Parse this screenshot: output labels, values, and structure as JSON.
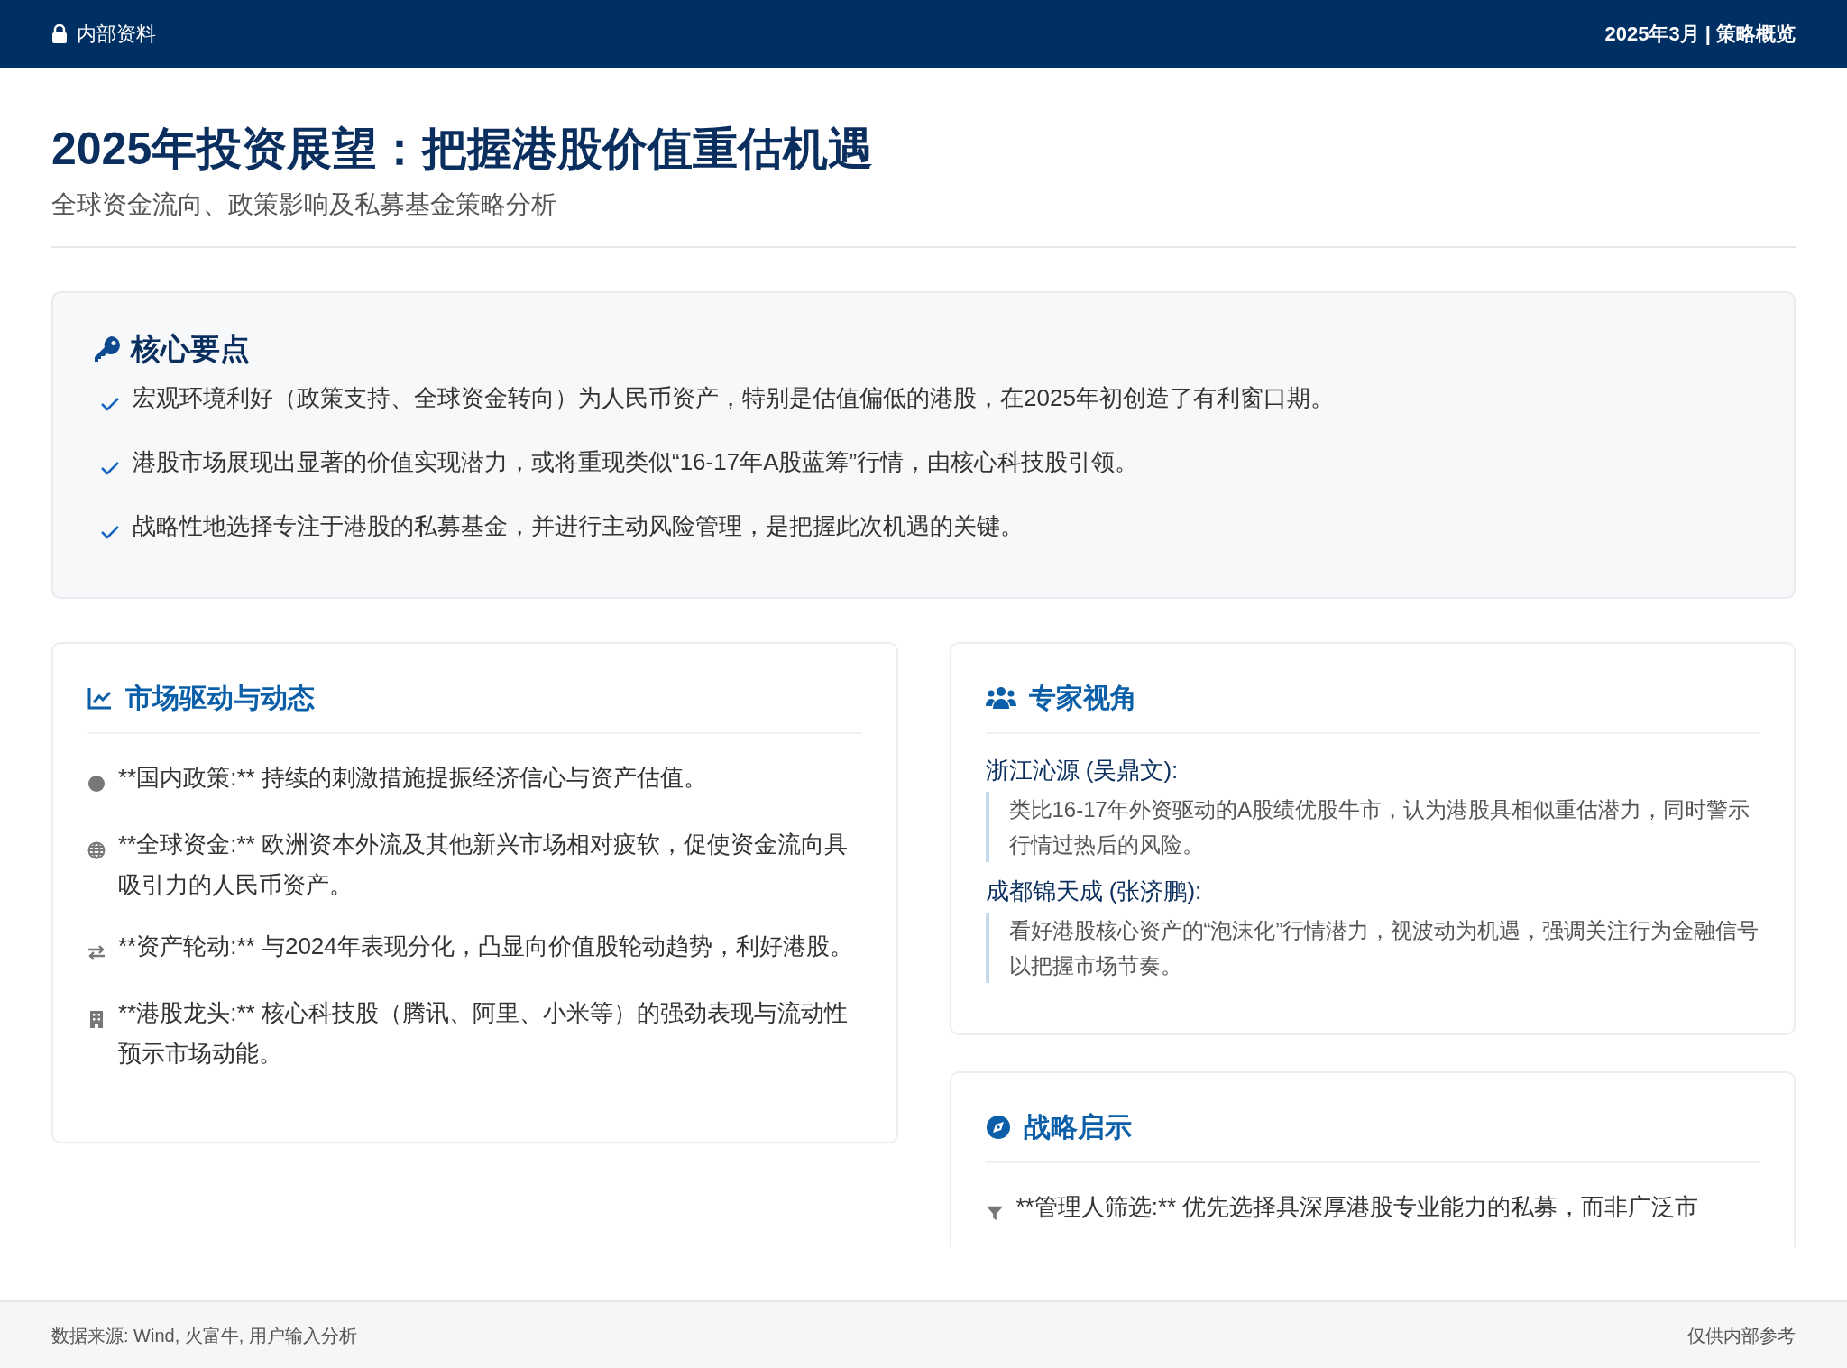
{
  "header": {
    "label": "内部资料",
    "meta": "2025年3月 | 策略概览"
  },
  "title": "2025年投资展望：把握港股价值重估机遇",
  "subtitle": "全球资金流向、政策影响及私募基金策略分析",
  "key_points": {
    "heading": "核心要点",
    "items": [
      "宏观环境利好（政策支持、全球资金转向）为人民币资产，特别是估值偏低的港股，在2025年初创造了有利窗口期。",
      "港股市场展现出显著的价值实现潜力，或将重现类似“16-17年A股蓝筹”行情，由核心科技股引领。",
      "战略性地选择专注于港股的私募基金，并进行主动风险管理，是把握此次机遇的关键。"
    ]
  },
  "market_drivers": {
    "heading": "市场驱动与动态",
    "items": [
      {
        "kind": "dot",
        "text": "**国内政策:** 持续的刺激措施提振经济信心与资产估值。"
      },
      {
        "kind": "globe",
        "text": "**全球资金:** 欧洲资本外流及其他新兴市场相对疲软，促使资金流向具吸引力的人民币资产。"
      },
      {
        "kind": "exchange",
        "text": "**资产轮动:** 与2024年表现分化，凸显向价值股轮动趋势，利好港股。"
      },
      {
        "kind": "building",
        "text": "**港股龙头:** 核心科技股（腾讯、阿里、小米等）的强劲表现与流动性预示市场动能。"
      }
    ]
  },
  "expert_views": {
    "heading": "专家视角",
    "experts": [
      {
        "name": "浙江沁源 (吴鼎文):",
        "quote": "类比16-17年外资驱动的A股绩优股牛市，认为港股具相似重估潜力，同时警示行情过热后的风险。"
      },
      {
        "name": "成都锦天成 (张济鹏):",
        "quote": "看好港股核心资产的“泡沫化”行情潜力，视波动为机遇，强调关注行为金融信号以把握市场节奏。"
      }
    ]
  },
  "strategy": {
    "heading": "战略启示",
    "items": [
      {
        "kind": "filter",
        "text": "**管理人筛选:** 优先选择具深厚港股专业能力的私募，而非广泛市"
      }
    ]
  },
  "footer": {
    "source": "数据来源: Wind, 火富牛, 用户输入分析",
    "note": "仅供内部参考"
  }
}
